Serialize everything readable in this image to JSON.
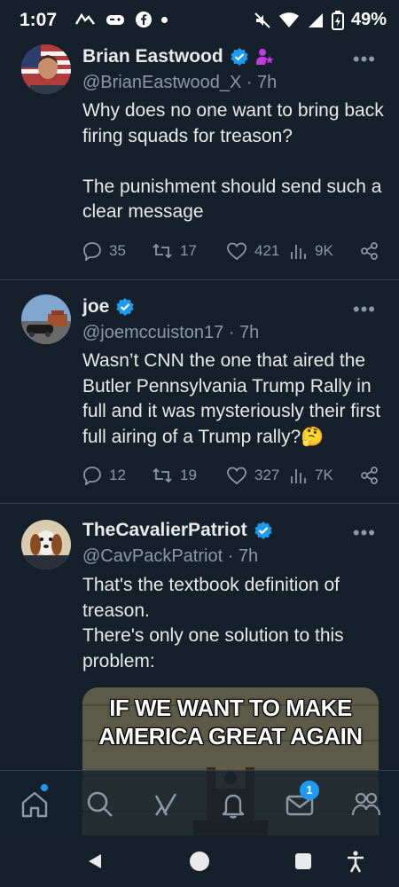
{
  "status_bar": {
    "time": "1:07",
    "battery": "49%"
  },
  "tweets": [
    {
      "name": "Brian Eastwood",
      "handle": "@BrianEastwood_X · 7h",
      "text": "Why does no one want to bring back firing squads for treason?\n\nThe punishment should send such a clear message",
      "replies": "35",
      "retweets": "17",
      "likes": "421",
      "views": "9K"
    },
    {
      "name": "joe",
      "handle": "@joemccuiston17 · 7h",
      "text": "Wasn’t CNN the one that aired the Butler Pennsylvania Trump Rally in full and it was mysteriously their first full airing of a Trump rally?🤔",
      "replies": "12",
      "retweets": "19",
      "likes": "327",
      "views": "7K"
    },
    {
      "name": "TheCavalierPatriot",
      "handle": "@CavPackPatriot · 7h",
      "text": "That's the textbook definition of treason.\nThere's only one solution to this problem:",
      "media_line1": "IF WE WANT TO MAKE",
      "media_line2": "AMERICA GREAT AGAIN"
    }
  ],
  "tabbar": {
    "messages_badge": "1"
  },
  "colors": {
    "accent": "#1d9bf0",
    "background": "#15202b",
    "muted": "#8b98a5",
    "verified": "#1d9bf0"
  }
}
